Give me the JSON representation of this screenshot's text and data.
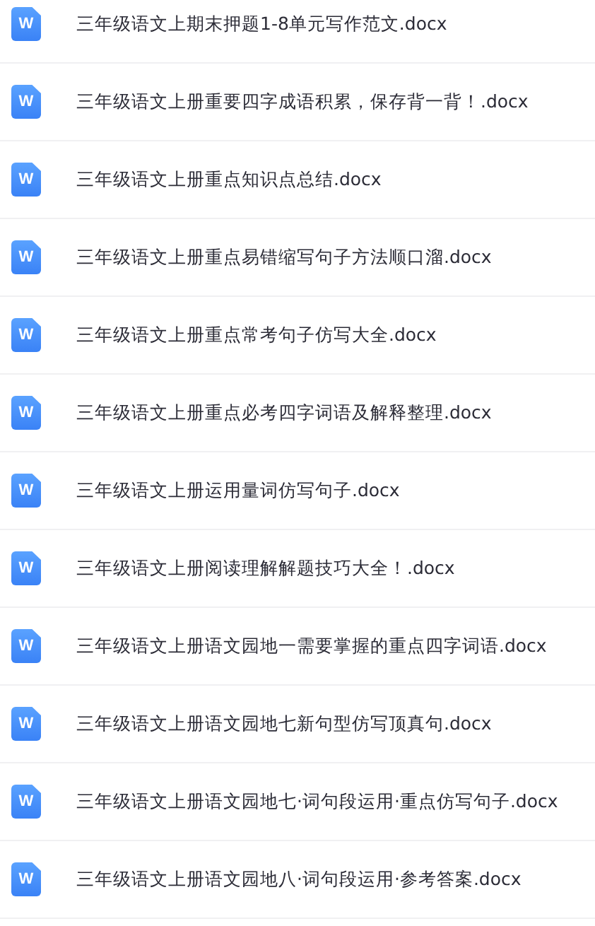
{
  "files": [
    {
      "icon_letter": "W",
      "name": "三年级语文上期末押题1-8单元写作范文.docx"
    },
    {
      "icon_letter": "W",
      "name": "三年级语文上册重要四字成语积累，保存背一背！.docx"
    },
    {
      "icon_letter": "W",
      "name": "三年级语文上册重点知识点总结.docx"
    },
    {
      "icon_letter": "W",
      "name": "三年级语文上册重点易错缩写句子方法顺口溜.docx"
    },
    {
      "icon_letter": "W",
      "name": "三年级语文上册重点常考句子仿写大全.docx"
    },
    {
      "icon_letter": "W",
      "name": "三年级语文上册重点必考四字词语及解释整理.docx"
    },
    {
      "icon_letter": "W",
      "name": "三年级语文上册运用量词仿写句子.docx"
    },
    {
      "icon_letter": "W",
      "name": "三年级语文上册阅读理解解题技巧大全！.docx"
    },
    {
      "icon_letter": "W",
      "name": "三年级语文上册语文园地一需要掌握的重点四字词语.docx"
    },
    {
      "icon_letter": "W",
      "name": "三年级语文上册语文园地七新句型仿写顶真句.docx"
    },
    {
      "icon_letter": "W",
      "name": "三年级语文上册语文园地七·词句段运用·重点仿写句子.docx"
    },
    {
      "icon_letter": "W",
      "name": "三年级语文上册语文园地八·词句段运用·参考答案.docx"
    }
  ]
}
